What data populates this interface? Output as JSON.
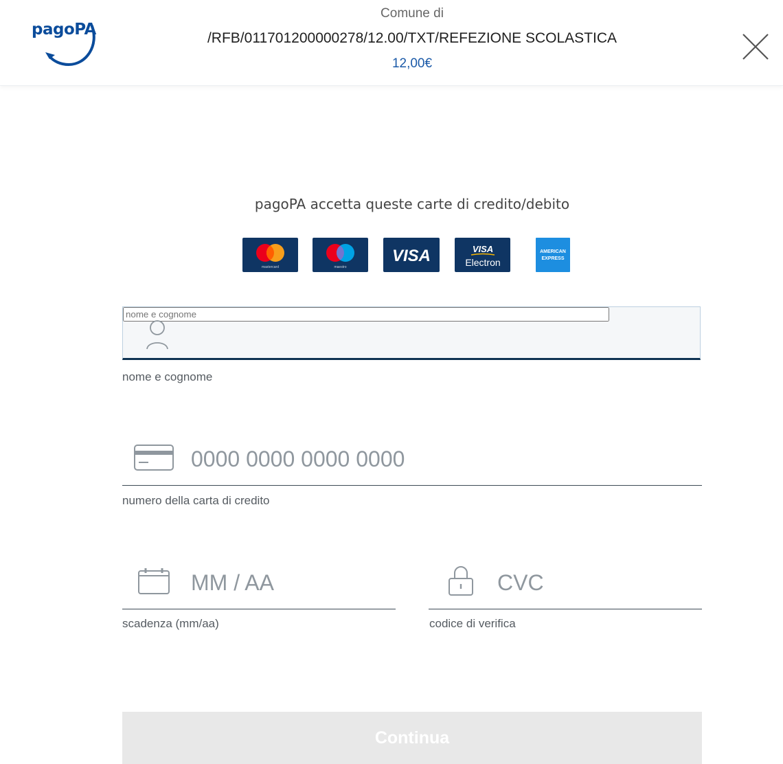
{
  "header": {
    "logo_text": "pagoPA",
    "subtitle": "Comune di",
    "payment_code": "/RFB/011701200000278/12.00/TXT/REFEZIONE SCOLASTICA",
    "amount": "12,00€",
    "close_icon": "close-icon"
  },
  "cards": {
    "title": "pagoPA accetta queste carte di credito/debito",
    "items": [
      {
        "name": "mastercard",
        "caption": "mastercard"
      },
      {
        "name": "maestro",
        "caption": "maestro"
      },
      {
        "name": "visa",
        "caption": "VISA"
      },
      {
        "name": "visa-electron",
        "caption": "VISA",
        "sub": "Electron"
      },
      {
        "name": "american-express",
        "caption": "AMERICAN",
        "sub": "EXPRESS"
      }
    ]
  },
  "form": {
    "name": {
      "placeholder": "nome e cognome",
      "value": "",
      "label": "nome e cognome",
      "icon": "user-icon"
    },
    "card_number": {
      "placeholder": "0000 0000 0000 0000",
      "value": "",
      "label": "numero della carta di credito",
      "icon": "credit-card-icon"
    },
    "expiry": {
      "placeholder": "MM / AA",
      "value": "",
      "label": "scadenza (mm/aa)",
      "icon": "calendar-icon"
    },
    "cvc": {
      "placeholder": "CVC",
      "value": "",
      "label": "codice di verifica",
      "icon": "lock-icon"
    }
  },
  "actions": {
    "continue_label": "Continua"
  },
  "colors": {
    "brand_blue": "#0b4c9b",
    "amount_blue": "#1b5aa8",
    "card_navy": "#0f3563",
    "amex_blue": "#1d8ee0",
    "button_disabled": "#e8e8e8"
  }
}
